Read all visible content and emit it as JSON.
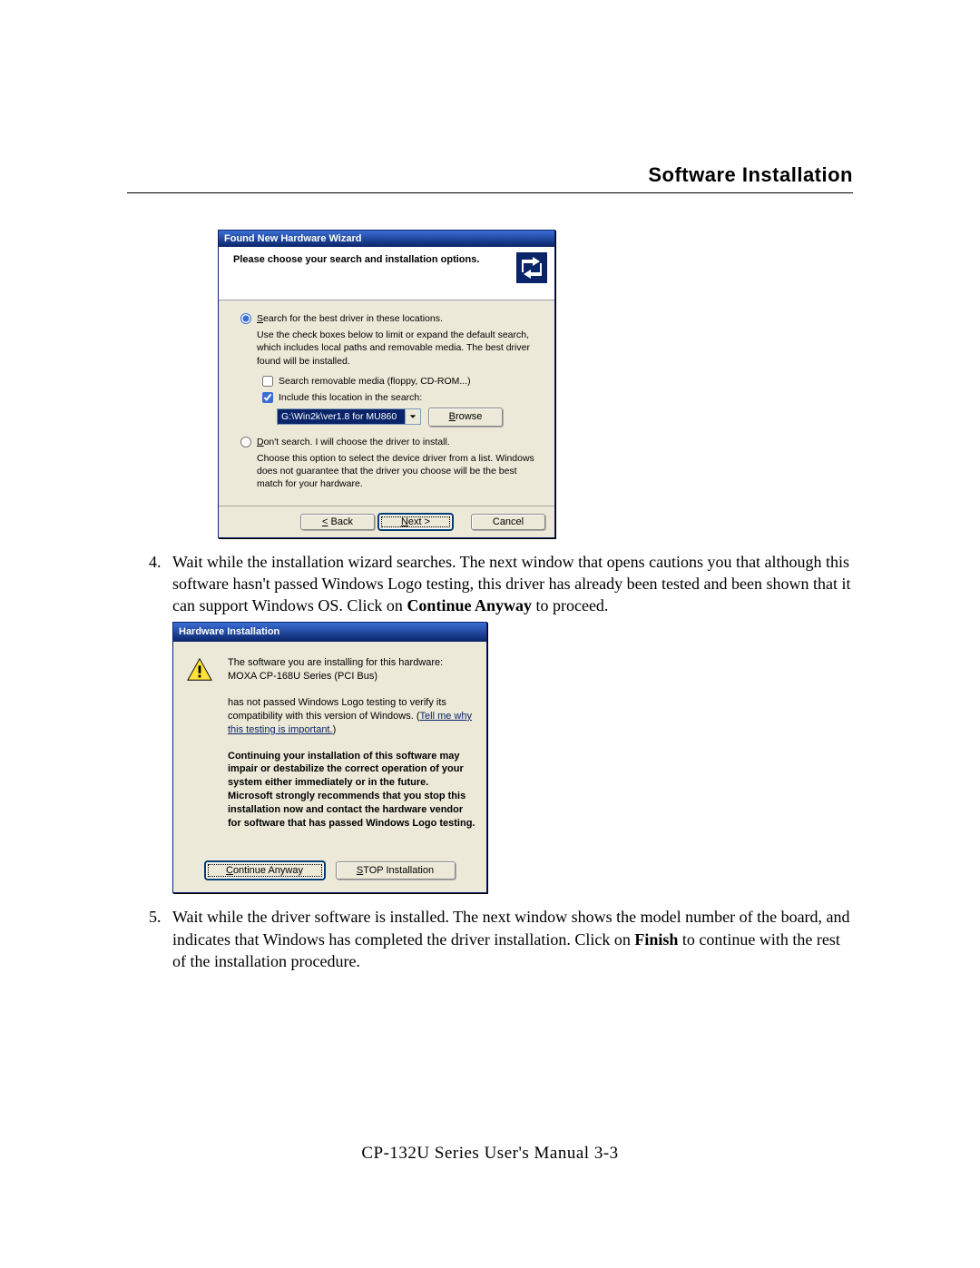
{
  "header": {
    "title": "Software Installation"
  },
  "footer": {
    "text": "CP-132U Series User's Manual 3-3"
  },
  "wizard": {
    "title": "Found New Hardware Wizard",
    "subtitle": "Please choose your search and installation options.",
    "radio_search": "Search for the best driver in these locations.",
    "search_desc": "Use the check boxes below to limit or expand the default search, which includes local paths and removable media. The best driver found will be installed.",
    "chk_removable": "Search removable media (floppy, CD-ROM...)",
    "chk_include": "Include this location in the search:",
    "path_value": "G:\\Win2k\\ver1.8 for MU860",
    "browse": "Browse",
    "radio_noSearch": "Don't search. I will choose the driver to install.",
    "noSearch_desc": "Choose this option to select the device driver from a list. Windows does not guarantee that the driver you choose will be the best match for your hardware.",
    "back": "< Back",
    "next": "Next >",
    "cancel": "Cancel"
  },
  "step4": {
    "text_a": "Wait while the installation wizard searches. The next window that opens cautions you that although this software hasn't passed Windows Logo testing, this driver has already been tested and been shown that it can support Windows OS. Click on ",
    "text_b": "Continue Anyway",
    "text_c": " to proceed."
  },
  "warning": {
    "title": "Hardware Installation",
    "line1": "The software you are installing for this hardware:",
    "device": "MOXA CP-168U Series (PCI Bus)",
    "line2_a": "has not passed Windows Logo testing to verify its compatibility with this version of Windows. (",
    "link": "Tell me why this testing is important.",
    "line2_c": ")",
    "strong": "Continuing your installation of this software may impair or destabilize the correct operation of your system either immediately or in the future. Microsoft strongly recommends that you stop this installation now and contact the hardware vendor for software that has passed Windows Logo testing.",
    "continue": "Continue Anyway",
    "stop": "STOP Installation"
  },
  "step5": {
    "text_a": "Wait while the driver software is installed. The next window shows the model number of the board, and indicates that Windows has completed the driver installation. Click on ",
    "text_b": "Finish",
    "text_c": " to continue with the rest of the installation procedure."
  }
}
